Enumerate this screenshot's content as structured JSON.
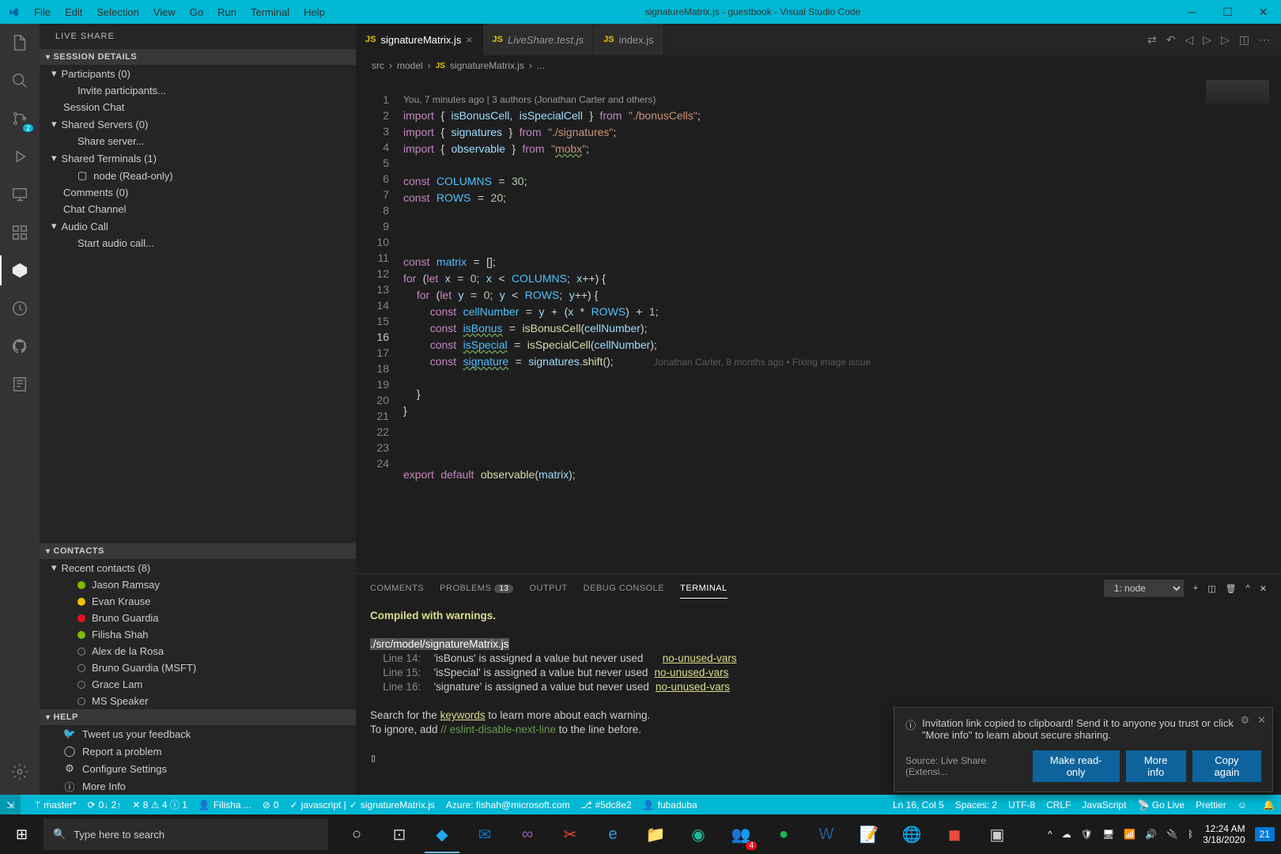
{
  "titlebar": {
    "menus": [
      "File",
      "Edit",
      "Selection",
      "View",
      "Go",
      "Run",
      "Terminal",
      "Help"
    ],
    "title": "signatureMatrix.js - guestbook - Visual Studio Code"
  },
  "sidebar": {
    "title": "LIVE SHARE",
    "session": {
      "header": "SESSION DETAILS",
      "participants": "Participants (0)",
      "invite": "Invite participants...",
      "sessionChat": "Session Chat",
      "sharedServers": "Shared Servers (0)",
      "shareServer": "Share server...",
      "sharedTerminals": "Shared Terminals (1)",
      "terminalNode": "node (Read-only)",
      "comments": "Comments (0)",
      "chatChannel": "Chat Channel",
      "audioCall": "Audio Call",
      "startAudio": "Start audio call..."
    },
    "contacts": {
      "header": "CONTACTS",
      "recent": "Recent contacts (8)",
      "list": [
        {
          "name": "Jason Ramsay",
          "status": "green"
        },
        {
          "name": "Evan Krause",
          "status": "yellow"
        },
        {
          "name": "Bruno Guardia",
          "status": "red"
        },
        {
          "name": "Filisha Shah",
          "status": "green"
        },
        {
          "name": "Alex de la Rosa",
          "status": "none"
        },
        {
          "name": "Bruno Guardia (MSFT)",
          "status": "none"
        },
        {
          "name": "Grace Lam",
          "status": "none"
        },
        {
          "name": "MS Speaker",
          "status": "none"
        }
      ]
    },
    "help": {
      "header": "HELP",
      "items": [
        "Tweet us your feedback",
        "Report a problem",
        "Configure Settings",
        "More Info"
      ]
    }
  },
  "tabs": [
    {
      "file": "signatureMatrix.js",
      "active": true,
      "dirty": false
    },
    {
      "file": "LiveShare.test.js",
      "active": false,
      "italic": true
    },
    {
      "file": "index.js",
      "active": false
    }
  ],
  "breadcrumb": [
    "src",
    "model",
    "signatureMatrix.js",
    "..."
  ],
  "codelens": "You, 7 minutes ago | 3 authors (Jonathan Carter and others)",
  "inlineBlame": "Jonathan Carter, 8 months ago • Fixing image issue",
  "panel": {
    "tabs": {
      "comments": "COMMENTS",
      "problems": "PROBLEMS",
      "problemsCount": "13",
      "output": "OUTPUT",
      "debug": "DEBUG CONSOLE",
      "terminal": "TERMINAL"
    },
    "select": "1: node",
    "terminal": {
      "line1": "Compiled with warnings.",
      "file": "./src/model/signatureMatrix.js",
      "warnings": [
        {
          "line": "Line 14:",
          "msg": "'isBonus' is assigned a value but never used",
          "rule": "no-unused-vars"
        },
        {
          "line": "Line 15:",
          "msg": "'isSpecial' is assigned a value but never used",
          "rule": "no-unused-vars"
        },
        {
          "line": "Line 16:",
          "msg": "'signature' is assigned a value but never used",
          "rule": "no-unused-vars"
        }
      ],
      "search1": "Search for the ",
      "keywords": "keywords",
      "search2": " to learn more about each warning.",
      "ignore1": "To ignore, add ",
      "eslintComment": "// eslint-disable-next-line",
      "ignore2": " to the line before."
    }
  },
  "notification": {
    "msg": "Invitation link copied to clipboard! Send it to anyone you trust or click \"More info\" to learn about secure sharing.",
    "source": "Source: Live Share (Extensi...",
    "btn1": "Make read-only",
    "btn2": "More info",
    "btn3": "Copy again"
  },
  "statusbar": {
    "branch": "master*",
    "sync": "0↓ 2↑",
    "errors": "✕ 8 ⚠ 4 ⓘ 1",
    "liveshare": "Filisha ...",
    "count0": "0",
    "lang": "javascript | ",
    "file": "signatureMatrix.js",
    "azure": "Azure: fishah@microsoft.com",
    "commit": "#5dc8e2",
    "user": "fubaduba",
    "pos": "Ln 16, Col 5",
    "spaces": "Spaces: 2",
    "encoding": "UTF-8",
    "eol": "CRLF",
    "langMode": "JavaScript",
    "golive": "Go Live",
    "prettier": "Prettier"
  },
  "taskbar": {
    "search": "Type here to search",
    "time": "12:24 AM",
    "date": "3/18/2020",
    "notifCount": "21",
    "teamsBadge": "4"
  },
  "chart_data": null
}
